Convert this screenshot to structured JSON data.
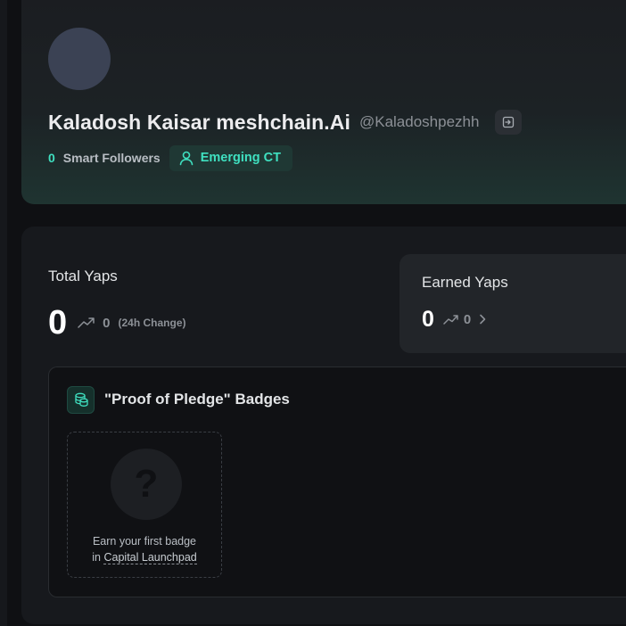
{
  "profile": {
    "display_name": "Kaladosh Kaisar meshchain.Ai",
    "handle": "@Kaladoshpezhh",
    "smart_followers_count": "0",
    "smart_followers_label": "Smart Followers",
    "tier": "Emerging CT"
  },
  "yaps": {
    "total_title": "Total Yaps",
    "total_value": "0",
    "total_change": "0",
    "change_note": "(24h Change)",
    "earned_title": "Earned Yaps",
    "earned_value": "0",
    "earned_change": "0"
  },
  "badges": {
    "title": "\"Proof of Pledge\" Badges",
    "empty_prefix": "Earn your first badge",
    "empty_in": "in",
    "empty_link": "Capital Launchpad"
  },
  "colors": {
    "accent": "#3fe0c0",
    "background": "#0f1013",
    "card": "#17191d"
  },
  "icons": [
    "external-link-icon",
    "user-icon",
    "trend-up-icon",
    "chevron-right-icon",
    "coins-icon",
    "question-icon"
  ]
}
